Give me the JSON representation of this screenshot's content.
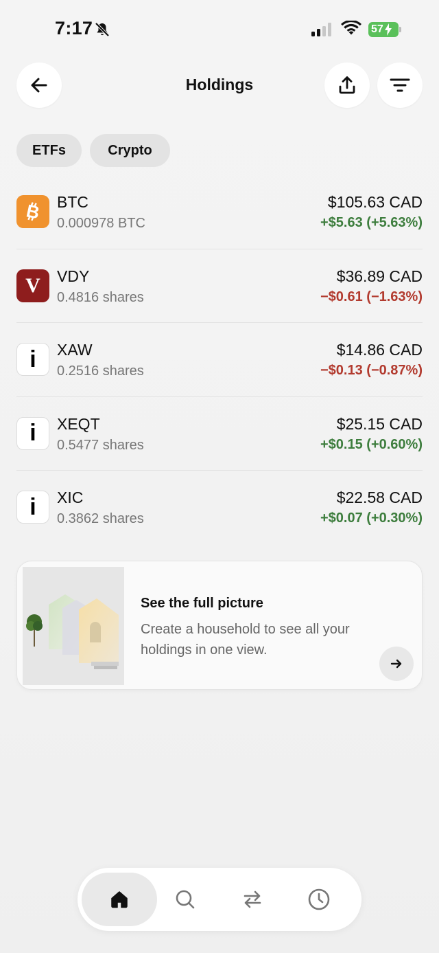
{
  "status_bar": {
    "time": "7:17",
    "battery": "57"
  },
  "header": {
    "title": "Holdings"
  },
  "filters": [
    {
      "label": "ETFs"
    },
    {
      "label": "Crypto"
    }
  ],
  "holdings": [
    {
      "symbol": "BTC",
      "quantity": "0.000978 BTC",
      "value": "$105.63 CAD",
      "change": "+$5.63 (+5.63%)",
      "direction": "up",
      "logo": "bitcoin-icon"
    },
    {
      "symbol": "VDY",
      "quantity": "0.4816 shares",
      "value": "$36.89 CAD",
      "change": "−$0.61 (−1.63%)",
      "direction": "down",
      "logo": "vanguard-logo",
      "logo_text": "V"
    },
    {
      "symbol": "XAW",
      "quantity": "0.2516 shares",
      "value": "$14.86 CAD",
      "change": "−$0.13 (−0.87%)",
      "direction": "down",
      "logo": "ishares-logo",
      "logo_text": "i"
    },
    {
      "symbol": "XEQT",
      "quantity": "0.5477 shares",
      "value": "$25.15 CAD",
      "change": "+$0.15 (+0.60%)",
      "direction": "up",
      "logo": "ishares-logo",
      "logo_text": "i"
    },
    {
      "symbol": "XIC",
      "quantity": "0.3862 shares",
      "value": "$22.58 CAD",
      "change": "+$0.07 (+0.30%)",
      "direction": "up",
      "logo": "ishares-logo",
      "logo_text": "i"
    }
  ],
  "promo": {
    "title": "See the full picture",
    "body": "Create a household to see all your holdings in one view."
  },
  "nav": {
    "items": [
      {
        "icon": "home-icon",
        "active": true
      },
      {
        "icon": "search-icon",
        "active": false
      },
      {
        "icon": "transfer-icon",
        "active": false
      },
      {
        "icon": "activity-clock-icon",
        "active": false
      }
    ]
  },
  "colors": {
    "positive": "#3d7d3d",
    "negative": "#b23a2e",
    "bitcoin": "#f0922e",
    "vanguard": "#8e1d1d",
    "battery": "#5ac05a"
  }
}
